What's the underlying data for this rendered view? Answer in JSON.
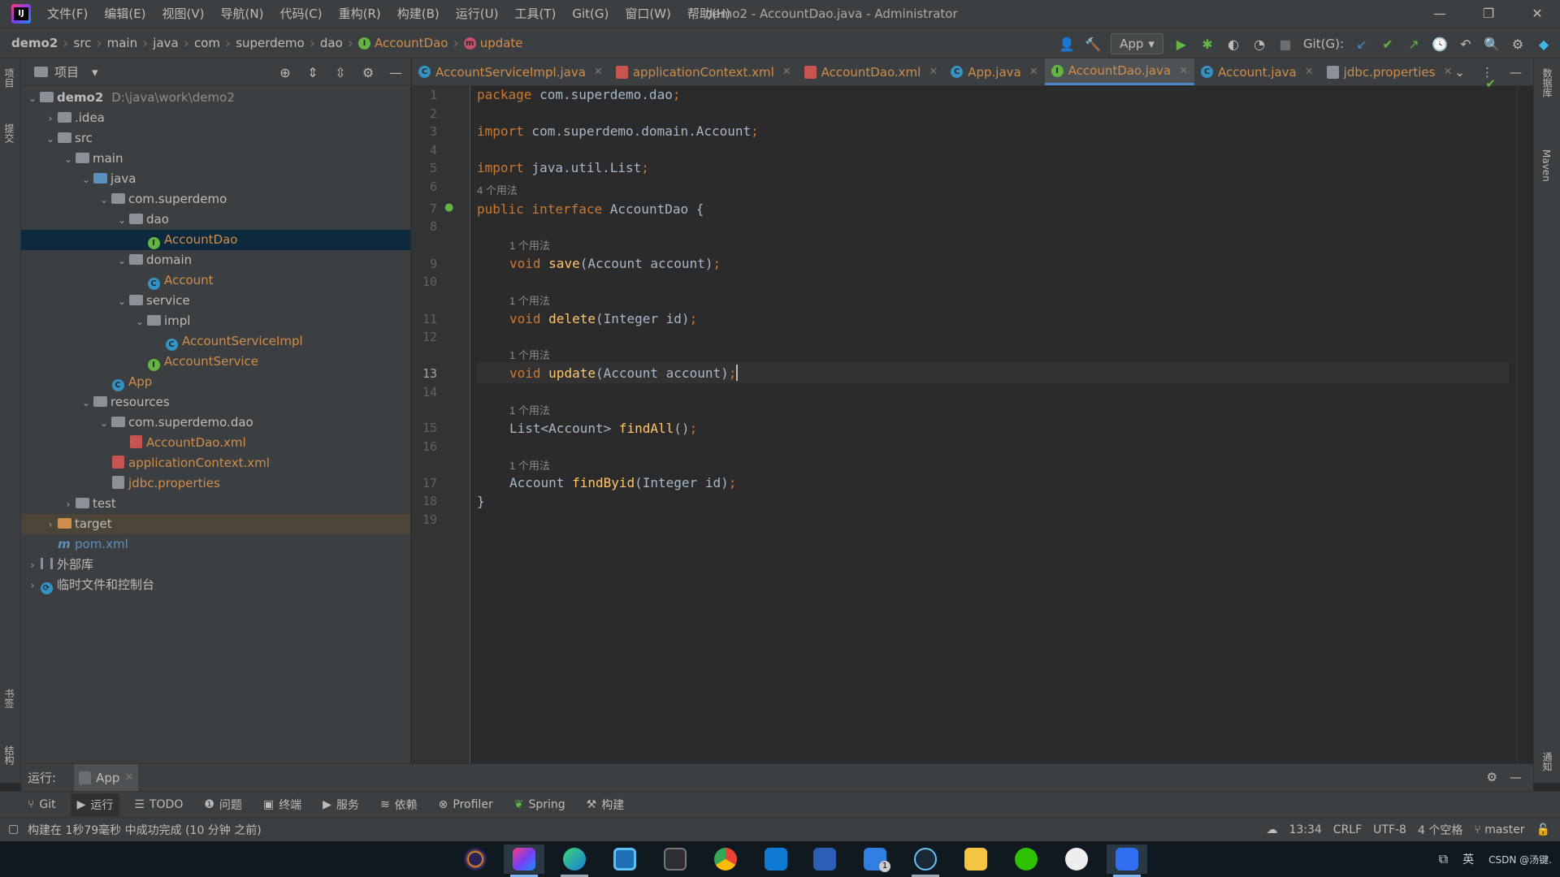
{
  "window": {
    "title": "demo2 - AccountDao.java - Administrator",
    "menu": [
      "文件(F)",
      "编辑(E)",
      "视图(V)",
      "导航(N)",
      "代码(C)",
      "重构(R)",
      "构建(B)",
      "运行(U)",
      "工具(T)",
      "Git(G)",
      "窗口(W)",
      "帮助(H)"
    ],
    "controls": {
      "minimize": "—",
      "restore": "❐",
      "close": "✕"
    }
  },
  "breadcrumbs": [
    "demo2",
    "src",
    "main",
    "java",
    "com",
    "superdemo",
    "dao",
    "AccountDao",
    "update"
  ],
  "navbar": {
    "run_config": "App",
    "git_label": "Git(G):"
  },
  "left_strip": {
    "top_label": "项目",
    "second_label": "提交",
    "bottom_label": "书签",
    "bottom2_label": "结构"
  },
  "right_strip": {
    "top_label": "数据库",
    "maven_label": "Maven",
    "notify_label": "通知"
  },
  "project": {
    "title": "项目",
    "tree": [
      {
        "depth": 0,
        "arrow": "⌄",
        "icon": "module",
        "label": "demo2",
        "extra": "D:\\java\\work\\demo2",
        "style": "strong"
      },
      {
        "depth": 1,
        "arrow": "›",
        "icon": "folder",
        "label": ".idea"
      },
      {
        "depth": 1,
        "arrow": "⌄",
        "icon": "folder",
        "label": "src"
      },
      {
        "depth": 2,
        "arrow": "⌄",
        "icon": "folder",
        "label": "main"
      },
      {
        "depth": 3,
        "arrow": "⌄",
        "icon": "folder-blue",
        "label": "java"
      },
      {
        "depth": 4,
        "arrow": "⌄",
        "icon": "package",
        "label": "com.superdemo"
      },
      {
        "depth": 5,
        "arrow": "⌄",
        "icon": "package",
        "label": "dao"
      },
      {
        "depth": 6,
        "arrow": "",
        "icon": "interface",
        "label": "AccountDao",
        "style": "orange",
        "selected": true
      },
      {
        "depth": 5,
        "arrow": "⌄",
        "icon": "package",
        "label": "domain"
      },
      {
        "depth": 6,
        "arrow": "",
        "icon": "class",
        "label": "Account",
        "style": "orange"
      },
      {
        "depth": 5,
        "arrow": "⌄",
        "icon": "package",
        "label": "service"
      },
      {
        "depth": 6,
        "arrow": "⌄",
        "icon": "package",
        "label": "impl"
      },
      {
        "depth": 7,
        "arrow": "",
        "icon": "class",
        "label": "AccountServiceImpl",
        "style": "orange"
      },
      {
        "depth": 6,
        "arrow": "",
        "icon": "interface",
        "label": "AccountService",
        "style": "orange"
      },
      {
        "depth": 4,
        "arrow": "",
        "icon": "class-run",
        "label": "App",
        "style": "orange"
      },
      {
        "depth": 3,
        "arrow": "⌄",
        "icon": "folder-res",
        "label": "resources"
      },
      {
        "depth": 4,
        "arrow": "⌄",
        "icon": "folder",
        "label": "com.superdemo.dao"
      },
      {
        "depth": 5,
        "arrow": "",
        "icon": "xml",
        "label": "AccountDao.xml",
        "style": "orange"
      },
      {
        "depth": 4,
        "arrow": "",
        "icon": "xml",
        "label": "applicationContext.xml",
        "style": "orange"
      },
      {
        "depth": 4,
        "arrow": "",
        "icon": "props",
        "label": "jdbc.properties",
        "style": "orange"
      },
      {
        "depth": 2,
        "arrow": "›",
        "icon": "folder",
        "label": "test"
      },
      {
        "depth": 1,
        "arrow": "›",
        "icon": "folder-orange",
        "label": "target",
        "highlight": true
      },
      {
        "depth": 1,
        "arrow": "",
        "icon": "maven",
        "label": "pom.xml",
        "style": "blue"
      },
      {
        "depth": 0,
        "arrow": "›",
        "icon": "library",
        "label": "外部库"
      },
      {
        "depth": 0,
        "arrow": "›",
        "icon": "scratch",
        "label": "临时文件和控制台"
      }
    ]
  },
  "tabs": [
    {
      "label": "AccountServiceImpl.java",
      "icon": "class"
    },
    {
      "label": "applicationContext.xml",
      "icon": "xml"
    },
    {
      "label": "AccountDao.xml",
      "icon": "xml"
    },
    {
      "label": "App.java",
      "icon": "class"
    },
    {
      "label": "AccountDao.java",
      "icon": "interface",
      "active": true
    },
    {
      "label": "Account.java",
      "icon": "class"
    },
    {
      "label": "jdbc.properties",
      "icon": "props"
    }
  ],
  "editor": {
    "line_numbers": [
      "1",
      "2",
      "3",
      "4",
      "5",
      "6",
      "7",
      "8",
      "9",
      "10",
      "11",
      "12",
      "13",
      "14",
      "15",
      "16",
      "17",
      "18",
      "19"
    ],
    "current_line": "13",
    "hints": {
      "interface": "4 个用法",
      "save": "1 个用法",
      "delete": "1 个用法",
      "update": "1 个用法",
      "findAll": "1 个用法",
      "findById": "1 个用法"
    },
    "code": {
      "l1_kw": "package",
      "l1_rest": " com.superdemo.dao",
      "l3_kw": "import",
      "l3_rest": " com.superdemo.domain.Account",
      "l5_kw": "import",
      "l5_rest": " java.util.List",
      "l7_kw1": "public",
      "l7_kw2": "interface",
      "l7_rest": " AccountDao {",
      "l9_kw": "void",
      "l9_fn": "save",
      "l9_rest": "(Account account)",
      "l11_kw": "void",
      "l11_fn": "delete",
      "l11_rest": "(Integer id)",
      "l13_kw": "void",
      "l13_fn": "update",
      "l13_rest": "(Account account)",
      "l15_pre": "List<Account> ",
      "l15_fn": "findAll",
      "l15_rest": "()",
      "l17_pre": "Account ",
      "l17_fn": "findByid",
      "l17_rest": "(Integer id)",
      "l18": "}",
      "semi": ";"
    }
  },
  "runbar": {
    "label": "运行:",
    "tab": "App"
  },
  "toolwindows": [
    "Git",
    "运行",
    "TODO",
    "问题",
    "终端",
    "服务",
    "依赖",
    "Profiler",
    "Spring",
    "构建"
  ],
  "status": {
    "message": "构建在 1秒79毫秒 中成功完成 (10 分钟 之前)",
    "position": "13:34",
    "line_sep": "CRLF",
    "encoding": "UTF-8",
    "indent": "4 个空格",
    "branch": "master"
  },
  "taskbar": {
    "apps": [
      "eclipse",
      "intellij",
      "edge-beta",
      "virtualbox",
      "terminal",
      "chrome",
      "vscode",
      "word",
      "todo",
      "steam",
      "explorer",
      "wechat",
      "game",
      "player"
    ],
    "todo_badge": "1",
    "tray_text": "CSDN @汤键.",
    "ime": "英"
  },
  "colors": {
    "keyword": "#cc7832",
    "function": "#ffc66d",
    "text": "#a9b7c6",
    "orange_file": "#d08d4a",
    "selection": "#0d293e",
    "accent": "#4a88c7"
  }
}
